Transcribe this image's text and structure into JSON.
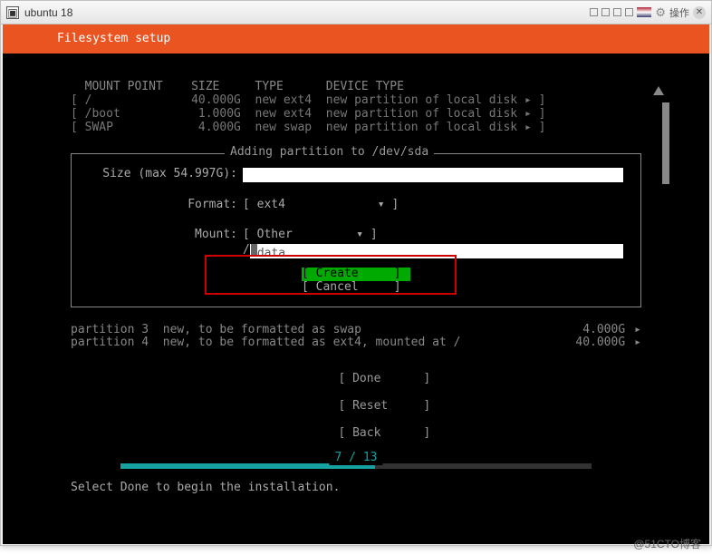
{
  "window": {
    "title": "ubuntu 18",
    "action_label": "操作"
  },
  "header": {
    "title": "Filesystem setup"
  },
  "columns": {
    "mount": "MOUNT POINT",
    "size": "SIZE",
    "type": "TYPE",
    "device_type": "DEVICE TYPE"
  },
  "rows": [
    {
      "mount": "/",
      "size": "40.000G",
      "type": "new ext4",
      "device_type": "new partition of local disk"
    },
    {
      "mount": "/boot",
      "size": "1.000G",
      "type": "new ext4",
      "device_type": "new partition of local disk"
    },
    {
      "mount": "SWAP",
      "size": "4.000G",
      "type": "new swap",
      "device_type": "new partition of local disk"
    }
  ],
  "dialog": {
    "title": "Adding partition to /dev/sda",
    "size_label": "Size (max 54.997G):",
    "format_label": "Format:",
    "format_value": "[ ext4             ▾ ]",
    "mount_label": "Mount:",
    "mount_value": "[ Other         ▾ ]",
    "mount_prefix": "/",
    "mount_path": "data",
    "create": "[ Create     ]",
    "cancel": "[ Cancel     ]"
  },
  "partitions": [
    {
      "name": "partition 3",
      "desc": "new, to be formatted as swap",
      "size": "4.000G"
    },
    {
      "name": "partition 4",
      "desc": "new, to be formatted as ext4, mounted at /",
      "size": "40.000G"
    }
  ],
  "nav": {
    "done": "[ Done      ]",
    "reset": "[ Reset     ]",
    "back": "[ Back      ]"
  },
  "progress": {
    "label": "7 / 13",
    "percent": 54
  },
  "hint": "Select Done to begin the installation.",
  "watermark": "@51CTO博客"
}
